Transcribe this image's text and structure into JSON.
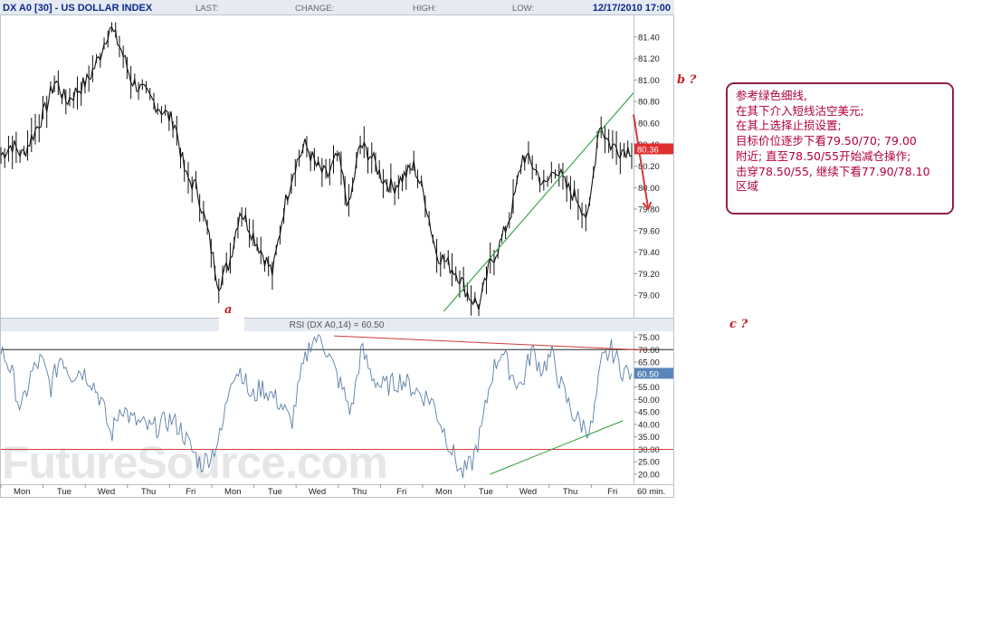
{
  "header": {
    "symbol": "DX A0 [30] - US DOLLAR INDEX",
    "last_label": "LAST:",
    "change_label": "CHANGE:",
    "high_label": "HIGH:",
    "low_label": "LOW:",
    "datetime": "12/17/2010 17:00"
  },
  "watermark": "FutureSource.com",
  "annotations": {
    "a": "a",
    "b": "b ?",
    "c": "c ?"
  },
  "note_lines": [
    "参考绿色细线,",
    "在其下介入短线沽空美元;",
    "在其上选择止损设置;",
    "目标价位逐步下看79.50/70; 79.00",
    "附近; 直至78.50/55开始减仓操作;",
    "击穿78.50/55, 继续下看77.90/78.10",
    "区域"
  ],
  "colors": {
    "header_bg": "#e6ebf2",
    "header_title": "#0c2b8c",
    "price_line": "#111111",
    "rsi_line": "#5b7fa8",
    "trend_green": "#2e9e3a",
    "trend_red": "#d23a3a",
    "price_tag": "#e03030",
    "rsi_tag": "#5a85b8",
    "watermark": "#e6e6e6",
    "note_border": "#8e2348",
    "note_text": "#b3003b",
    "annotation": "#cc1e1e"
  },
  "chart_data": [
    {
      "type": "line",
      "title": "DX A0 [30] - US DOLLAR INDEX",
      "y_axis_side": "right",
      "ylim": [
        78.8,
        81.6
      ],
      "yticks": [
        "81.40",
        "81.20",
        "81.00",
        "80.80",
        "80.60",
        "80.40",
        "80.20",
        "80.00",
        "79.80",
        "79.60",
        "79.40",
        "79.20",
        "79.00"
      ],
      "x_tick_labels": [
        "Mon",
        "Tue",
        "Wed",
        "Thu",
        "Fri",
        "Mon",
        "Tue",
        "Wed",
        "Thu",
        "Fri",
        "Mon",
        "Tue",
        "Wed",
        "Thu",
        "Fri"
      ],
      "x_unit_label": "60 min.",
      "last_value": "80.36",
      "series": [
        {
          "values": [
            80.3,
            80.4,
            80.3,
            80.5,
            80.7,
            81.0,
            80.8,
            80.9,
            81.0,
            81.2,
            81.5,
            81.3,
            81.0,
            80.9,
            80.8,
            80.7,
            80.6,
            80.1,
            80.0,
            79.6,
            79.1,
            79.3,
            79.8,
            79.6,
            79.4,
            79.2,
            79.8,
            80.2,
            80.4,
            80.2,
            80.1,
            80.3,
            79.8,
            80.4,
            80.3,
            80.1,
            80.0,
            80.1,
            80.2,
            79.9,
            79.4,
            79.3,
            79.2,
            79.0,
            78.9,
            79.3,
            79.5,
            79.8,
            80.3,
            80.2,
            80.0,
            80.2,
            80.0,
            79.9,
            79.7,
            80.6,
            80.4,
            80.35,
            80.36
          ],
          "line_style": "hourly-ohlc"
        }
      ],
      "trendlines": [
        {
          "color": "green",
          "from": [
            10.5,
            78.85
          ],
          "to": [
            15.0,
            80.88
          ]
        },
        {
          "color": "red",
          "from": [
            15.0,
            80.68
          ],
          "to": [
            15.35,
            79.8
          ]
        }
      ]
    },
    {
      "type": "line",
      "title": "RSI (DX A0,14) = 60.50",
      "y_axis_side": "right",
      "ylim": [
        16,
        77
      ],
      "yticks": [
        "75.00",
        "70.00",
        "65.00",
        "60.00",
        "55.00",
        "50.00",
        "45.00",
        "40.00",
        "35.00",
        "30.00",
        "25.00",
        "20.00"
      ],
      "reference_lines": [
        70,
        30
      ],
      "last_value": "60.50",
      "series": [
        {
          "values": [
            70,
            62,
            45,
            60,
            66,
            55,
            68,
            60,
            62,
            58,
            50,
            35,
            48,
            42,
            40,
            38,
            40,
            42,
            38,
            30,
            24,
            28,
            36,
            60,
            62,
            50,
            55,
            52,
            48,
            40,
            60,
            74,
            75,
            65,
            55,
            45,
            70,
            60,
            55,
            56,
            58,
            55,
            52,
            50,
            40,
            30,
            20,
            24,
            38,
            60,
            70,
            60,
            55,
            70,
            62,
            68,
            55,
            45,
            40,
            38,
            65,
            70,
            62,
            60.5
          ],
          "line_style": "thin"
        }
      ],
      "trendlines": [
        {
          "color": "red",
          "from": [
            7.9,
            75.5
          ],
          "to": [
            15.3,
            69.8
          ]
        },
        {
          "color": "green",
          "from": [
            11.6,
            20.0
          ],
          "to": [
            14.75,
            41.5
          ]
        }
      ]
    }
  ]
}
